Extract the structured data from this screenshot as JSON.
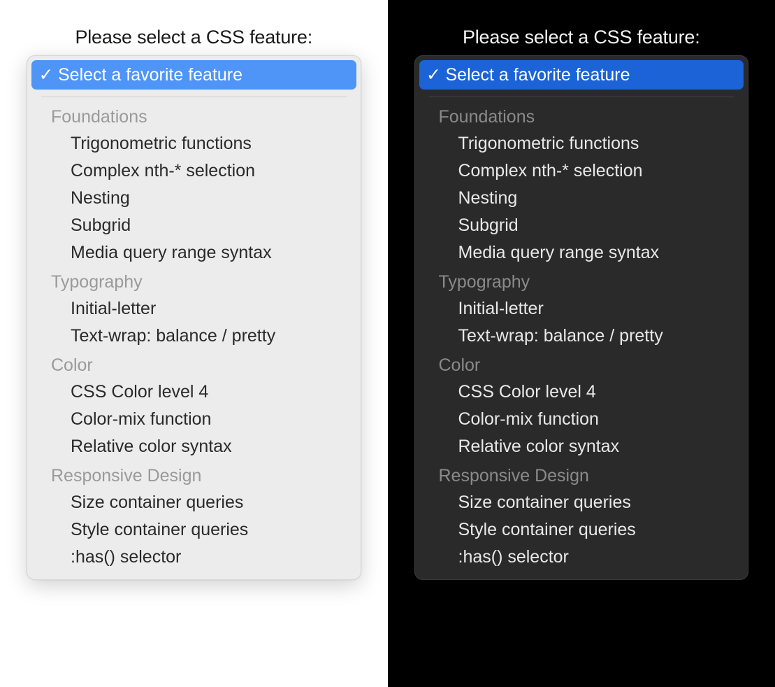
{
  "prompt": "Please select a CSS feature:",
  "selected_label": "Select a favorite feature",
  "check_glyph": "✓",
  "colors": {
    "light_bg": "#ffffff",
    "dark_bg": "#000000",
    "light_popup": "#ececec",
    "dark_popup": "#2a2a2a",
    "light_highlight": "#4f94f7",
    "dark_highlight": "#1b63d6"
  },
  "groups": [
    {
      "label": "Foundations",
      "options": [
        "Trigonometric functions",
        "Complex nth-* selection",
        "Nesting",
        "Subgrid",
        "Media query range syntax"
      ]
    },
    {
      "label": "Typography",
      "options": [
        "Initial-letter",
        "Text-wrap: balance / pretty"
      ]
    },
    {
      "label": "Color",
      "options": [
        "CSS Color level 4",
        "Color-mix function",
        "Relative color syntax"
      ]
    },
    {
      "label": "Responsive Design",
      "options": [
        "Size container queries",
        "Style container queries",
        ":has() selector"
      ]
    }
  ]
}
